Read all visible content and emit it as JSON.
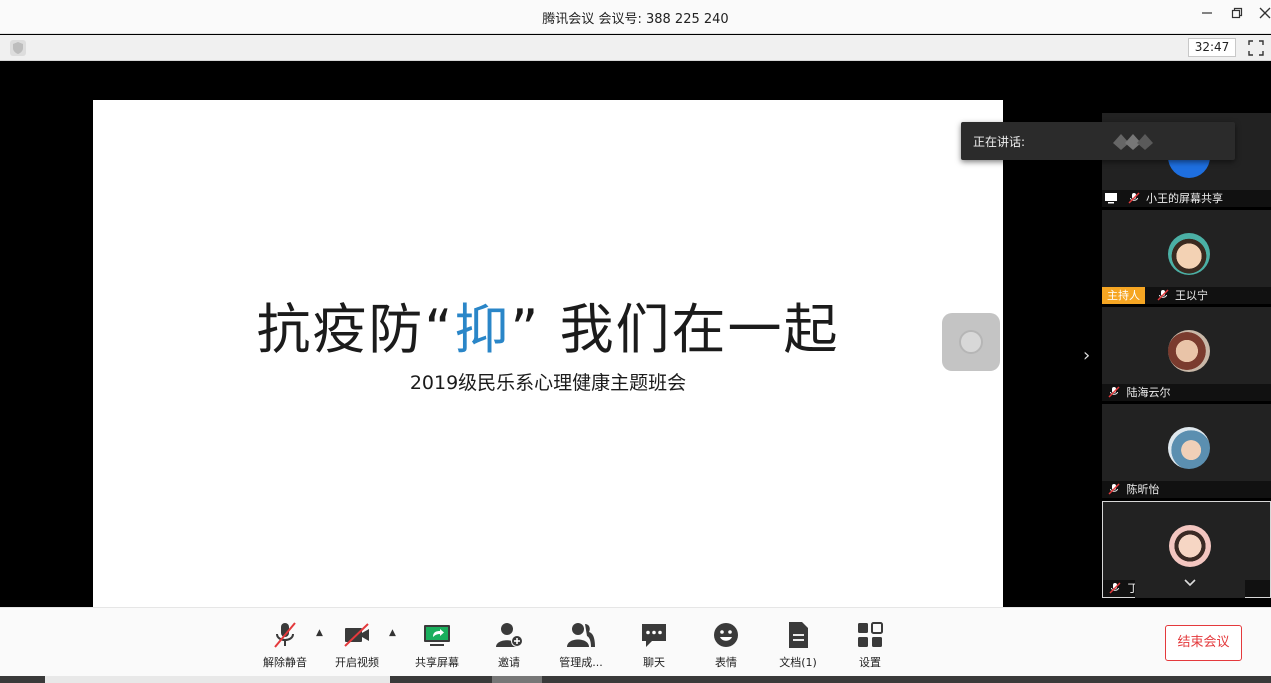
{
  "window": {
    "app_name": "腾讯会议",
    "meeting_label": "会议号:",
    "meeting_id": "388 225 240"
  },
  "infobar": {
    "timer": "32:47"
  },
  "slide": {
    "title_before": "抗疫防“",
    "title_highlight": "抑",
    "title_after": "” 我们在一起",
    "subtitle": "2019级民乐系心理健康主题班会",
    "highlight_color": "#2a86c8"
  },
  "speaking": {
    "label": "正在讲话:"
  },
  "participants": [
    {
      "name": "小王的屏幕共享",
      "host": false
    },
    {
      "name": "王以宁",
      "host": true,
      "host_label": "主持人"
    },
    {
      "name": "陆海云尔",
      "host": false
    },
    {
      "name": "陈昕怡",
      "host": false
    },
    {
      "name": "丁姝月",
      "host": false
    }
  ],
  "toolbar": {
    "unmute": "解除静音",
    "start_video": "开启视频",
    "share_screen": "共享屏幕",
    "invite": "邀请",
    "manage": "管理成...",
    "chat": "聊天",
    "reaction": "表情",
    "docs": "文档(1)",
    "settings": "设置",
    "end_meeting": "结束会议"
  },
  "colors": {
    "end_meeting": "#e4393c",
    "host_badge": "#f6a623",
    "share_icon": "#1aaf5d"
  }
}
